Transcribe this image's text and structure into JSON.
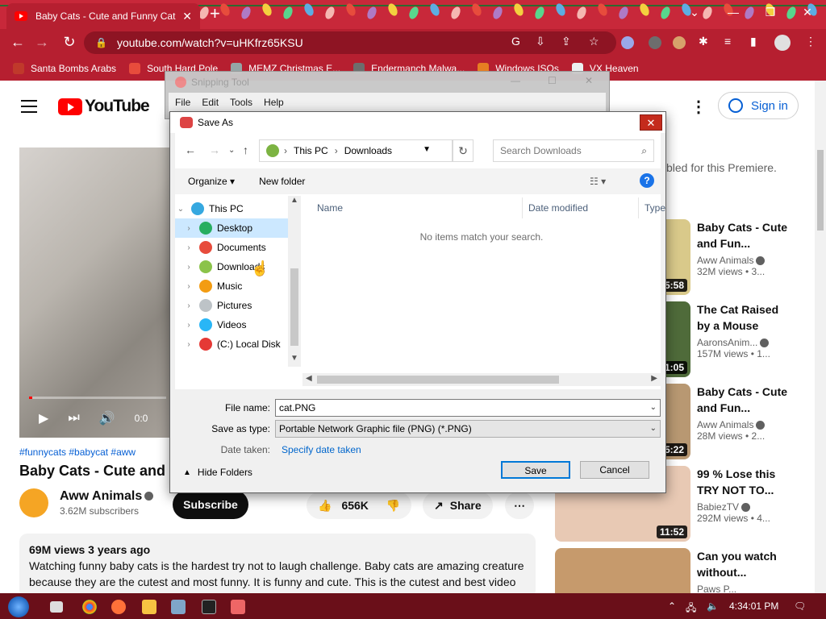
{
  "browser": {
    "tab_title": "Baby Cats - Cute and Funny Cat Videos",
    "tab_close": "✕",
    "new_tab": "+",
    "url": "youtube.com/watch?v=uHKfrz65KSU",
    "bookmarks": [
      {
        "label": "Santa Bombs Arabs",
        "color": "#c0392b"
      },
      {
        "label": "South Hard Pole",
        "color": "#e74c3c"
      },
      {
        "label": "MEMZ Christmas E...",
        "color": "#95a5a6"
      },
      {
        "label": "Endermanch Malwa...",
        "color": "#6d6d6d"
      },
      {
        "label": "Windows ISOs",
        "color": "#e67e22"
      },
      {
        "label": "VX Heaven",
        "color": "#ecf0f1"
      }
    ]
  },
  "youtube": {
    "logo_text": "YouTube",
    "sign_in": "Sign in",
    "more": "⋮",
    "premiere_note": "bled for this Premiere.",
    "hashtags": "#funnycats #babycat #aww",
    "video_title": "Baby Cats - Cute and",
    "player_time": "0:0",
    "channel": {
      "name": "Aww Animals",
      "subscribers": "3.62M subscribers"
    },
    "subscribe": "Subscribe",
    "likes": "656K",
    "share": "Share",
    "description": {
      "meta": "69M views  3 years ago",
      "text": "Watching funny baby cats is the hardest try not to laugh challenge. Baby cats are amazing creature because they are the cutest and most funny. It is funny and cute. This is the cutest and best video"
    },
    "recommendations": [
      {
        "title": "Baby Cats - Cute and Fun...",
        "channel": "Aww Animals",
        "views": "32M views • 3...",
        "duration": "5:58",
        "thumb": "#d9c98a"
      },
      {
        "title": "The Cat Raised by a Mouse",
        "channel": "AaronsAnim...",
        "views": "157M views • 1...",
        "duration": "1:05",
        "thumb": "#4f6b3a"
      },
      {
        "title": "Baby Cats - Cute and Fun...",
        "channel": "Aww Animals",
        "views": "28M views • 2...",
        "duration": "5:22",
        "thumb": "#b89872"
      },
      {
        "title": "99 % Lose this TRY NOT TO...",
        "channel": "BabiezTV",
        "views": "292M views • 4...",
        "duration": "11:52",
        "thumb": "#e8c9b4"
      },
      {
        "title": "Can you watch without...",
        "channel": "Paws P...",
        "views": "",
        "duration": "",
        "thumb": "#c69a6c"
      }
    ]
  },
  "snipping_tool": {
    "title": "Snipping Tool",
    "menu": [
      "File",
      "Edit",
      "Tools",
      "Help"
    ]
  },
  "save_dialog": {
    "title": "Save As",
    "close": "✕",
    "path": [
      "This PC",
      "Downloads"
    ],
    "search_placeholder": "Search Downloads",
    "organize": "Organize ▾",
    "new_folder": "New folder",
    "help": "?",
    "tree": [
      {
        "label": "This PC",
        "color": "#35a8e0",
        "expanded": true
      },
      {
        "label": "Desktop",
        "color": "#27ae60",
        "selected": true
      },
      {
        "label": "Documents",
        "color": "#e74c3c"
      },
      {
        "label": "Downloads",
        "color": "#8bc34a"
      },
      {
        "label": "Music",
        "color": "#f39c12"
      },
      {
        "label": "Pictures",
        "color": "#bdc3c7"
      },
      {
        "label": "Videos",
        "color": "#29b6f6"
      },
      {
        "label": "(C:) Local Disk",
        "color": "#e53935"
      }
    ],
    "columns": [
      "Name",
      "Date modified",
      "Type"
    ],
    "empty_message": "No items match your search.",
    "file_name_label": "File name:",
    "file_name": "cat.PNG",
    "save_as_type_label": "Save as type:",
    "save_as_type": "Portable Network Graphic file (PNG) (*.PNG)",
    "date_taken_label": "Date taken:",
    "date_taken_link": "Specify date taken",
    "hide_folders": "Hide Folders",
    "save": "Save",
    "cancel": "Cancel"
  },
  "taskbar": {
    "time": "4:34:01 PM"
  }
}
